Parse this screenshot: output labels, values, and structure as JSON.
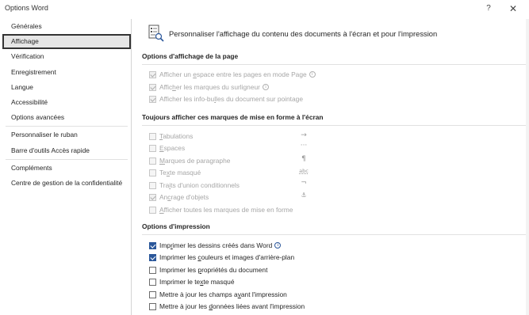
{
  "window": {
    "title": "Options Word",
    "help": "?",
    "close": "✕"
  },
  "sidebar": {
    "group1": [
      {
        "label": "Générales"
      },
      {
        "label": "Affichage",
        "selected": true
      },
      {
        "label": "Vérification"
      },
      {
        "label": "Enregistrement"
      },
      {
        "label": "Langue"
      },
      {
        "label": "Accessibilité"
      },
      {
        "label": "Options avancées"
      }
    ],
    "group2": [
      {
        "label": "Personnaliser le ruban"
      },
      {
        "label": "Barre d'outils Accès rapide"
      }
    ],
    "group3": [
      {
        "label": "Compléments"
      },
      {
        "label": "Centre de gestion de la confidentialité"
      }
    ]
  },
  "main": {
    "header": {
      "icon": "display-settings-icon",
      "text": "Personnaliser l'affichage du contenu des documents à l'écran et pour l'impression"
    },
    "sections": {
      "page_display": {
        "title": "Options d'affichage de la page",
        "options": [
          {
            "pre": "Afficher un ",
            "u": "e",
            "post": "space entre les pages en mode Page",
            "checked": true,
            "disabled": true,
            "info": true
          },
          {
            "pre": "Affic",
            "u": "h",
            "post": "er les marques du surligneur",
            "checked": true,
            "disabled": true,
            "info": true
          },
          {
            "pre": "Afficher les info-bu",
            "u": "l",
            "post": "les du document sur pointage",
            "checked": true,
            "disabled": true,
            "info": false
          }
        ]
      },
      "formatting_marks": {
        "title": "Toujours afficher ces marques de mise en forme à l'écran",
        "options": [
          {
            "pre": "",
            "u": "T",
            "post": "abulations",
            "checked": false,
            "disabled": true,
            "symbol": "→"
          },
          {
            "pre": "",
            "u": "E",
            "post": "spaces",
            "checked": false,
            "disabled": true,
            "symbol": "···"
          },
          {
            "pre": "",
            "u": "M",
            "post": "arques de paragraphe",
            "checked": false,
            "disabled": true,
            "symbol": "¶"
          },
          {
            "pre": "Te",
            "u": "x",
            "post": "te masqué",
            "checked": false,
            "disabled": true,
            "symbol": "abc"
          },
          {
            "pre": "Tra",
            "u": "i",
            "post": "ts d'union conditionnels",
            "checked": false,
            "disabled": true,
            "symbol": "¬"
          },
          {
            "pre": "An",
            "u": "c",
            "post": "rage d'objets",
            "checked": true,
            "disabled": true,
            "symbol": "⚓"
          },
          {
            "pre": "",
            "u": "A",
            "post": "fficher toutes les marques de mise en forme",
            "checked": false,
            "disabled": true,
            "symbol": ""
          }
        ]
      },
      "print_options": {
        "title": "Options d'impression",
        "options": [
          {
            "pre": "Imp",
            "u": "r",
            "post": "imer les dessins créés dans Word",
            "checked": true,
            "disabled": false,
            "info": true
          },
          {
            "pre": "Imprimer les ",
            "u": "c",
            "post": "ouleurs et images d'arrière-plan",
            "checked": true,
            "disabled": false,
            "info": false
          },
          {
            "pre": "Imprimer les ",
            "u": "p",
            "post": "ropriétés du document",
            "checked": false,
            "disabled": false,
            "info": false
          },
          {
            "pre": "Imprimer le te",
            "u": "x",
            "post": "te masqué",
            "checked": false,
            "disabled": false,
            "info": false
          },
          {
            "pre": "Mettre à jour les champs a",
            "u": "v",
            "post": "ant l'impression",
            "checked": false,
            "disabled": false,
            "info": false
          },
          {
            "pre": "Mettre à jour les ",
            "u": "d",
            "post": "onnées liées avant l'impression",
            "checked": false,
            "disabled": false,
            "info": false
          }
        ]
      }
    }
  },
  "colors": {
    "accent": "#2b579a",
    "disabled_text": "#a6a6a6",
    "text": "#262626"
  }
}
